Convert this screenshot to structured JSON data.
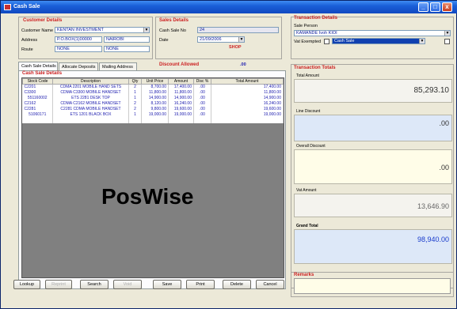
{
  "window": {
    "title": "Cash Sale",
    "minimize": "_",
    "maximize": "□",
    "close": "x"
  },
  "customer": {
    "title": "Customer Details",
    "name_label": "Customer Name",
    "name_value": "KENTAN INVESTMENT",
    "address_label": "Address",
    "address_value": "P.O.BOX(1)00000",
    "city_value": "NAIROBI",
    "route_label": "Route",
    "route_value": "NONE",
    "route_value2": "NONE"
  },
  "sales": {
    "title": "Sales Details",
    "no_label": "Cash Sale No",
    "no_value": "24",
    "date_label": "Date",
    "date_value": "21/09/2006",
    "shop_label": "SHOP"
  },
  "transaction": {
    "title": "Transaction Details",
    "person_label": "Sale Person",
    "person_value": "KAMANDE Ivoh KIOI",
    "vat_label": "Vat Exempted",
    "vat_value": "Cash Sale"
  },
  "tabs": [
    "Cash Sale Details",
    "Allocate Deposits",
    "Mailing Address"
  ],
  "discount": {
    "label": "Discount  Allowed",
    "value": ".00"
  },
  "grid": {
    "title": "Cash Sale Details",
    "columns": [
      "Stock Code",
      "Description",
      "Qty",
      "Unit Price",
      "Amount",
      "Disc %",
      "Total Amount"
    ],
    "rows": [
      [
        "C2201",
        "CDMA 2201 MOBILE HAND SETS",
        "2",
        "8,700.00",
        "17,400.00",
        ".00",
        "17,400.00"
      ],
      [
        "C3300",
        "CDMA C3300 MOBILE HANDSET",
        "1",
        "11,800.00",
        "11,800.00",
        ".00",
        "11,800.00"
      ],
      [
        "551160002",
        "ETS 2281 DESK TOP",
        "1",
        "14,900.00",
        "14,900.00",
        ".00",
        "14,900.00"
      ],
      [
        "C2162",
        "CDMA C2162 MOBILE HANDSET",
        "2",
        "8,120.00",
        "16,240.00",
        ".00",
        "16,240.00"
      ],
      [
        "C2281",
        "C2281 CDMA MOBILE HANDSET",
        "2",
        "9,800.00",
        "19,600.00",
        ".00",
        "19,600.00"
      ],
      [
        "51060171",
        "ETS 1201 BLACK BOX",
        "1",
        "19,000.00",
        "19,000.00",
        ".00",
        "19,000.00"
      ]
    ]
  },
  "watermark": "PosWise",
  "totals": {
    "title": "Transaction Totals",
    "total_label": "Total Amount",
    "total_value": "85,293.10",
    "line_label": "Line Discount",
    "line_value": ".00",
    "overall_label": "Overall Discount",
    "overall_value": ".00",
    "vat_label": "Vat Amount",
    "vat_value": "13,646.90",
    "grand_label": "Grand Total",
    "grand_value": "98,940.00"
  },
  "remarks": {
    "label": "Remarks"
  },
  "buttons": [
    "Lookup",
    "Reprint",
    "Search",
    "Void",
    "Save",
    "Print",
    "Delete",
    "Cancel"
  ],
  "colors": {
    "title_red": "#cc2222",
    "value_blue": "#2020b0",
    "grand_blue": "#1a3ccc"
  }
}
